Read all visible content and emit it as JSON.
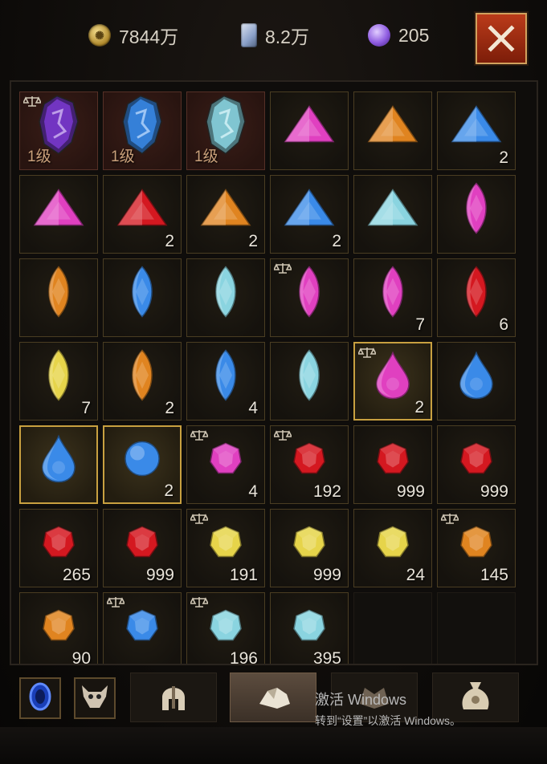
{
  "currencies": {
    "gold": {
      "value": "7844万",
      "icon": "gold-coin-icon"
    },
    "scroll": {
      "value": "8.2万",
      "icon": "scroll-icon"
    },
    "orb": {
      "value": "205",
      "icon": "purple-orb-icon"
    }
  },
  "close_icon": "close-icon",
  "items": [
    {
      "gem": "purple-rune-crystal",
      "level": "1级",
      "count": "",
      "locked": true
    },
    {
      "gem": "blue-rune-crystal",
      "level": "1级",
      "count": "",
      "locked": false
    },
    {
      "gem": "cyan-rune-crystal",
      "level": "1级",
      "count": "",
      "locked": false
    },
    {
      "gem": "pink-triangle-gem",
      "level": "",
      "count": "",
      "locked": false
    },
    {
      "gem": "orange-triangle-gem",
      "level": "",
      "count": "",
      "locked": false
    },
    {
      "gem": "blue-triangle-gem",
      "level": "",
      "count": "2",
      "locked": false
    },
    {
      "gem": "pink-triangle-gem",
      "level": "",
      "count": "",
      "locked": false
    },
    {
      "gem": "red-triangle-gem",
      "level": "",
      "count": "2",
      "locked": false
    },
    {
      "gem": "orange-triangle-gem",
      "level": "",
      "count": "2",
      "locked": false
    },
    {
      "gem": "blue-triangle-gem",
      "level": "",
      "count": "2",
      "locked": false
    },
    {
      "gem": "cyan-triangle-gem",
      "level": "",
      "count": "",
      "locked": false
    },
    {
      "gem": "pink-marquise-gem",
      "level": "",
      "count": "",
      "locked": false
    },
    {
      "gem": "orange-marquise-gem",
      "level": "",
      "count": "",
      "locked": false
    },
    {
      "gem": "blue-marquise-gem",
      "level": "",
      "count": "",
      "locked": false
    },
    {
      "gem": "cyan-marquise-gem",
      "level": "",
      "count": "",
      "locked": false
    },
    {
      "gem": "pink-marquise-gem",
      "level": "",
      "count": "",
      "locked": true
    },
    {
      "gem": "pink-marquise-gem",
      "level": "",
      "count": "7",
      "locked": false
    },
    {
      "gem": "red-marquise-gem",
      "level": "",
      "count": "6",
      "locked": false
    },
    {
      "gem": "yellow-marquise-gem",
      "level": "",
      "count": "7",
      "locked": false
    },
    {
      "gem": "orange-marquise-gem",
      "level": "",
      "count": "2",
      "locked": false
    },
    {
      "gem": "blue-marquise-gem",
      "level": "",
      "count": "4",
      "locked": false
    },
    {
      "gem": "cyan-marquise-gem",
      "level": "",
      "count": "",
      "locked": false
    },
    {
      "gem": "pink-teardrop-gem",
      "level": "",
      "count": "2",
      "locked": true,
      "selected": true
    },
    {
      "gem": "blue-teardrop-gem",
      "level": "",
      "count": "",
      "locked": false
    },
    {
      "gem": "blue-teardrop-gem",
      "level": "",
      "count": "",
      "locked": false,
      "selected": true
    },
    {
      "gem": "blue-orb-gem",
      "level": "",
      "count": "2",
      "locked": false,
      "selected": true
    },
    {
      "gem": "pink-round-gem",
      "level": "",
      "count": "4",
      "locked": true
    },
    {
      "gem": "red-round-gem",
      "level": "",
      "count": "192",
      "locked": true
    },
    {
      "gem": "red-round-gem",
      "level": "",
      "count": "999",
      "locked": false
    },
    {
      "gem": "red-round-gem",
      "level": "",
      "count": "999",
      "locked": false
    },
    {
      "gem": "red-round-gem",
      "level": "",
      "count": "265",
      "locked": false
    },
    {
      "gem": "red-round-gem",
      "level": "",
      "count": "999",
      "locked": false
    },
    {
      "gem": "yellow-round-gem",
      "level": "",
      "count": "191",
      "locked": true
    },
    {
      "gem": "yellow-round-gem",
      "level": "",
      "count": "999",
      "locked": false
    },
    {
      "gem": "yellow-round-gem",
      "level": "",
      "count": "24",
      "locked": false
    },
    {
      "gem": "orange-round-gem",
      "level": "",
      "count": "145",
      "locked": true
    },
    {
      "gem": "orange-round-gem",
      "level": "",
      "count": "90",
      "locked": false
    },
    {
      "gem": "blue-round-gem",
      "level": "",
      "count": "",
      "locked": true
    },
    {
      "gem": "cyan-round-gem",
      "level": "",
      "count": "196",
      "locked": true
    },
    {
      "gem": "cyan-round-gem",
      "level": "",
      "count": "395",
      "locked": false
    },
    {
      "gem": "empty",
      "level": "",
      "count": "",
      "locked": false,
      "empty": true
    },
    {
      "gem": "empty",
      "level": "",
      "count": "",
      "locked": false,
      "empty": true
    }
  ],
  "bottom_tabs": [
    {
      "name": "blue-portal-icon",
      "kind": "small"
    },
    {
      "name": "demon-mask-icon",
      "kind": "small"
    },
    {
      "name": "helmet-icon",
      "kind": "tab"
    },
    {
      "name": "gem-pile-icon",
      "kind": "tab",
      "active": true
    },
    {
      "name": "beast-icon",
      "kind": "tab"
    },
    {
      "name": "loot-bag-icon",
      "kind": "tab"
    }
  ],
  "watermark": {
    "line1": "激活 Windows",
    "line2": "转到“设置”以激活 Windows。"
  },
  "colors": {
    "pink": "#e040c0",
    "red": "#d41820",
    "orange": "#e08420",
    "blue": "#3a8ae8",
    "cyan": "#8ad4e0",
    "yellow": "#e6d44a",
    "purple": "#7a3ad0"
  }
}
